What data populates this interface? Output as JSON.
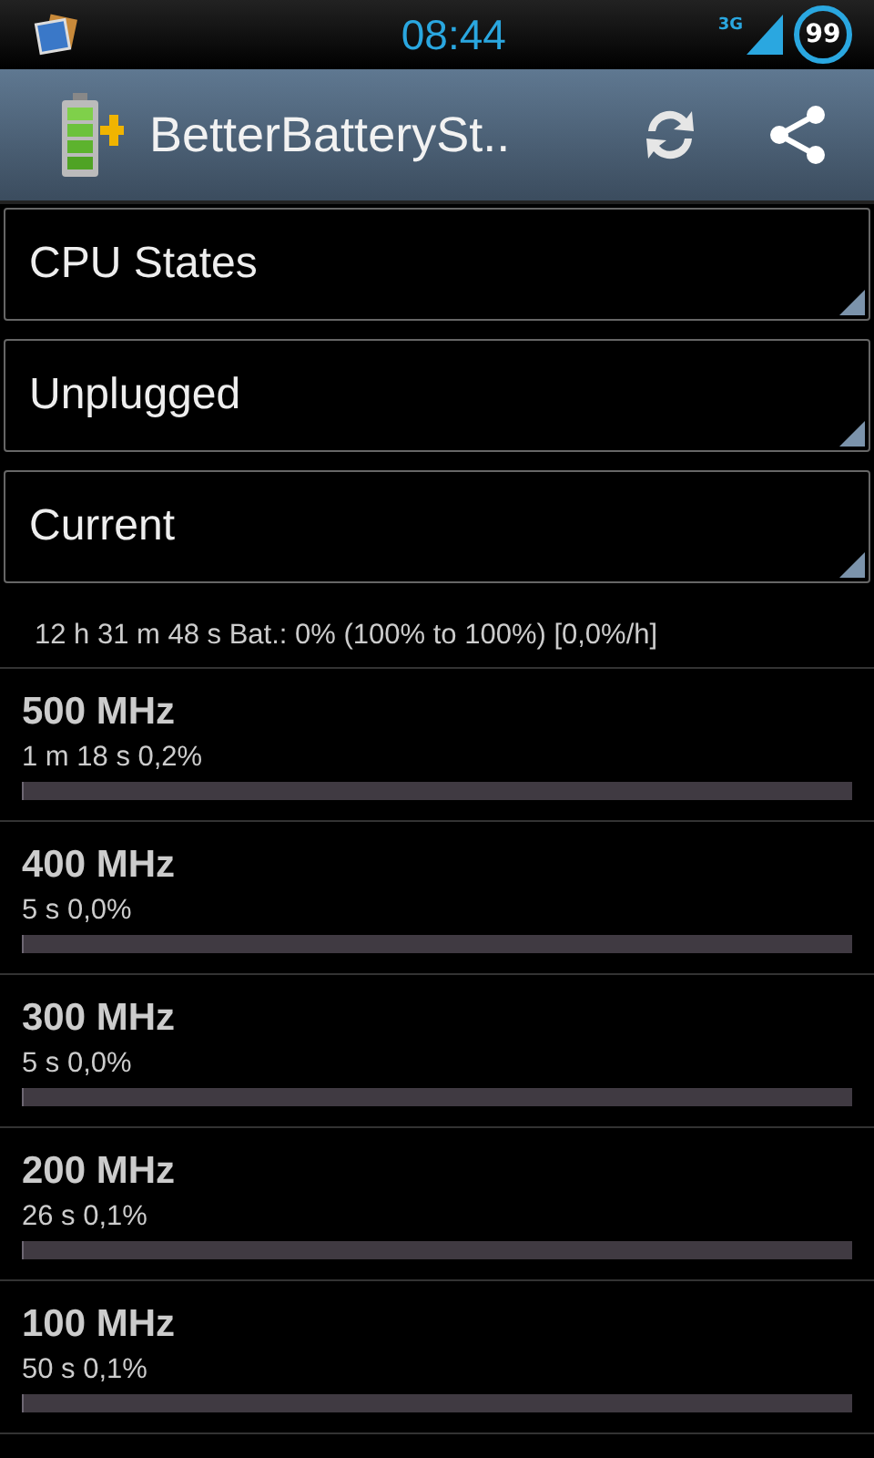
{
  "status_bar": {
    "time": "08:44",
    "network": "3G",
    "battery": "99"
  },
  "action_bar": {
    "title": "BetterBatterySt.."
  },
  "spinners": [
    {
      "label": "CPU States"
    },
    {
      "label": "Unplugged"
    },
    {
      "label": "Current"
    }
  ],
  "summary": "12 h 31 m 48 s  Bat.: 0% (100% to 100%) [0,0%/h]",
  "states": [
    {
      "name": "500 MHz",
      "detail": "1 m 18 s  0,2%",
      "level": 0.002
    },
    {
      "name": "400 MHz",
      "detail": "5 s  0,0%",
      "level": 0
    },
    {
      "name": "300 MHz",
      "detail": "5 s  0,0%",
      "level": 0
    },
    {
      "name": "200 MHz",
      "detail": "26 s  0,1%",
      "level": 0.001
    },
    {
      "name": "100 MHz",
      "detail": "50 s  0,1%",
      "level": 0.001
    }
  ]
}
